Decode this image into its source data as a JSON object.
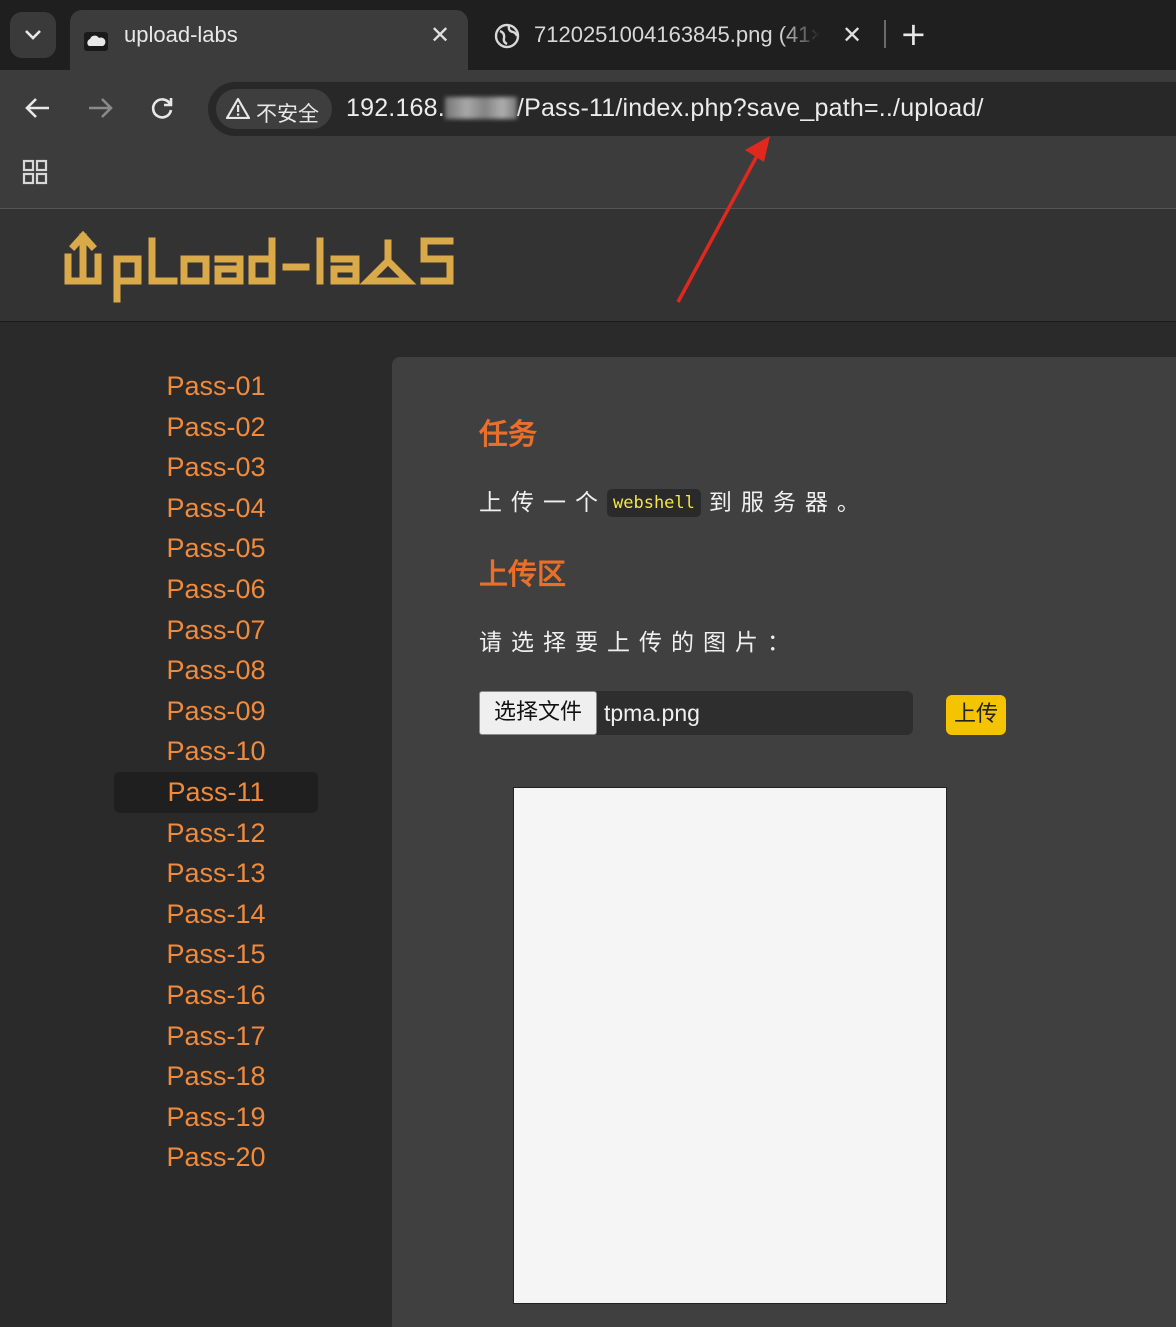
{
  "browser": {
    "tabs": [
      {
        "title": "upload-labs",
        "active": true
      },
      {
        "title": "7120251004163845.png (41×",
        "active": false
      }
    ],
    "new_tab_symbol": "+",
    "close_symbol": "✕",
    "security_label": "不安全",
    "url_prefix": "192.168.",
    "url_suffix": "/Pass-11/index.php?save_path=../upload/"
  },
  "page": {
    "logo_text": "UpLoad-labS",
    "nav": [
      "Pass-01",
      "Pass-02",
      "Pass-03",
      "Pass-04",
      "Pass-05",
      "Pass-06",
      "Pass-07",
      "Pass-08",
      "Pass-09",
      "Pass-10",
      "Pass-11",
      "Pass-12",
      "Pass-13",
      "Pass-14",
      "Pass-15",
      "Pass-16",
      "Pass-17",
      "Pass-18",
      "Pass-19",
      "Pass-20"
    ],
    "active_nav": "Pass-11",
    "task_title": "任务",
    "task_prefix": "上传一个",
    "task_code": "webshell",
    "task_suffix": "到服务器。",
    "upload_title": "上传区",
    "upload_prompt": "请选择要上传的图片：",
    "choose_file_label": "选择文件",
    "file_name": "tpma.png",
    "upload_button": "上传"
  },
  "colors": {
    "nav_link": "#f08a3c",
    "section_title": "#e8702a",
    "upload_button": "#f5c400",
    "logo": "#d9a94a",
    "annotation_arrow": "#e0281e"
  }
}
